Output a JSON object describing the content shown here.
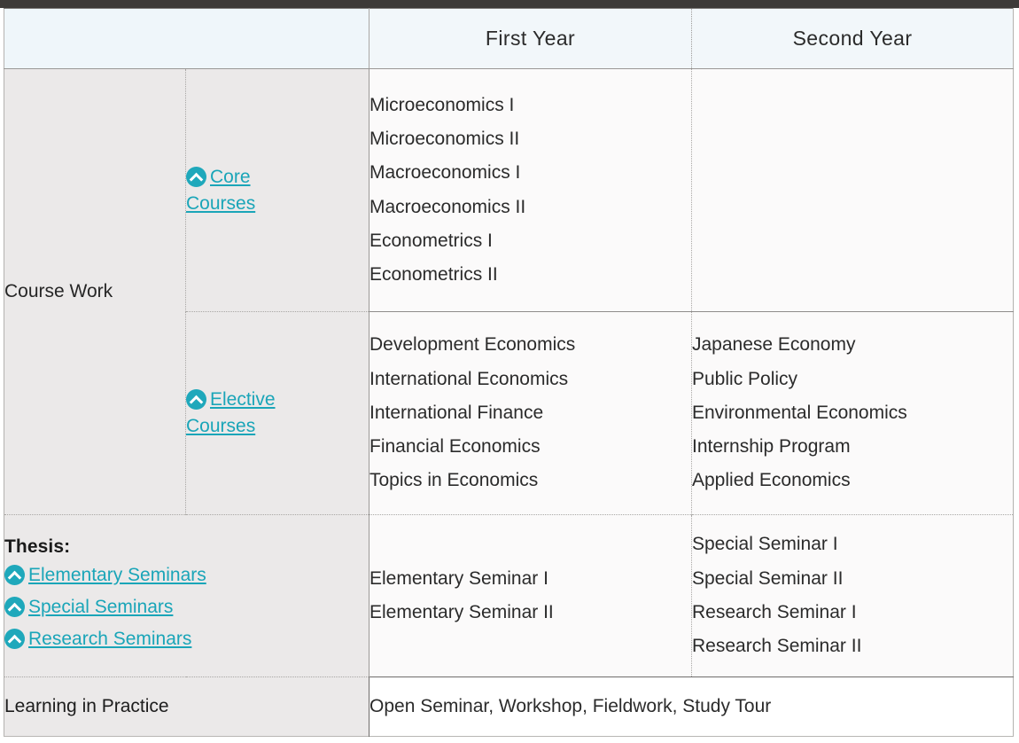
{
  "table": {
    "header": {
      "blank_label": "",
      "columns": [
        "First Year",
        "Second Year"
      ]
    },
    "rows": {
      "course_work": {
        "label": "Course Work",
        "core": {
          "link_label_line1": "Core",
          "link_label_line2": "Courses",
          "icon": "chevron-up-circle-icon",
          "first_year": [
            "Microeconomics I",
            "Microeconomics II",
            "Macroeconomics I",
            "Macroeconomics II",
            "Econometrics I",
            "Econometrics II"
          ],
          "second_year": []
        },
        "elective": {
          "link_label_line1": "Elective",
          "link_label_line2": "Courses",
          "icon": "chevron-up-circle-icon",
          "first_year": [
            "Development Economics",
            "International Economics",
            "International Finance",
            "Financial Economics",
            "Topics in Economics"
          ],
          "second_year": [
            "Japanese Economy",
            "Public Policy",
            "Environmental Economics",
            "Internship Program",
            "Applied Economics"
          ]
        }
      },
      "thesis": {
        "title": "Thesis:",
        "links": [
          "Elementary Seminars",
          "Special Seminars",
          "Research Seminars"
        ],
        "first_year": [
          "Elementary Seminar I",
          "Elementary Seminar II"
        ],
        "second_year": [
          "Special Seminar I",
          "Special Seminar II",
          "Research Seminar I",
          "Research Seminar II"
        ]
      },
      "learning_in_practice": {
        "label": "Learning in Practice",
        "value": "Open Seminar, Workshop, Fieldwork, Study Tour"
      }
    }
  },
  "colors": {
    "accent_teal": "#1aa5b8",
    "icon_teal": "#1fa8bb",
    "header_bg": "#f2f7fa",
    "label_bg": "#ebe9e9",
    "content_bg": "#fbfafa",
    "top_bar": "#3d3a38"
  }
}
